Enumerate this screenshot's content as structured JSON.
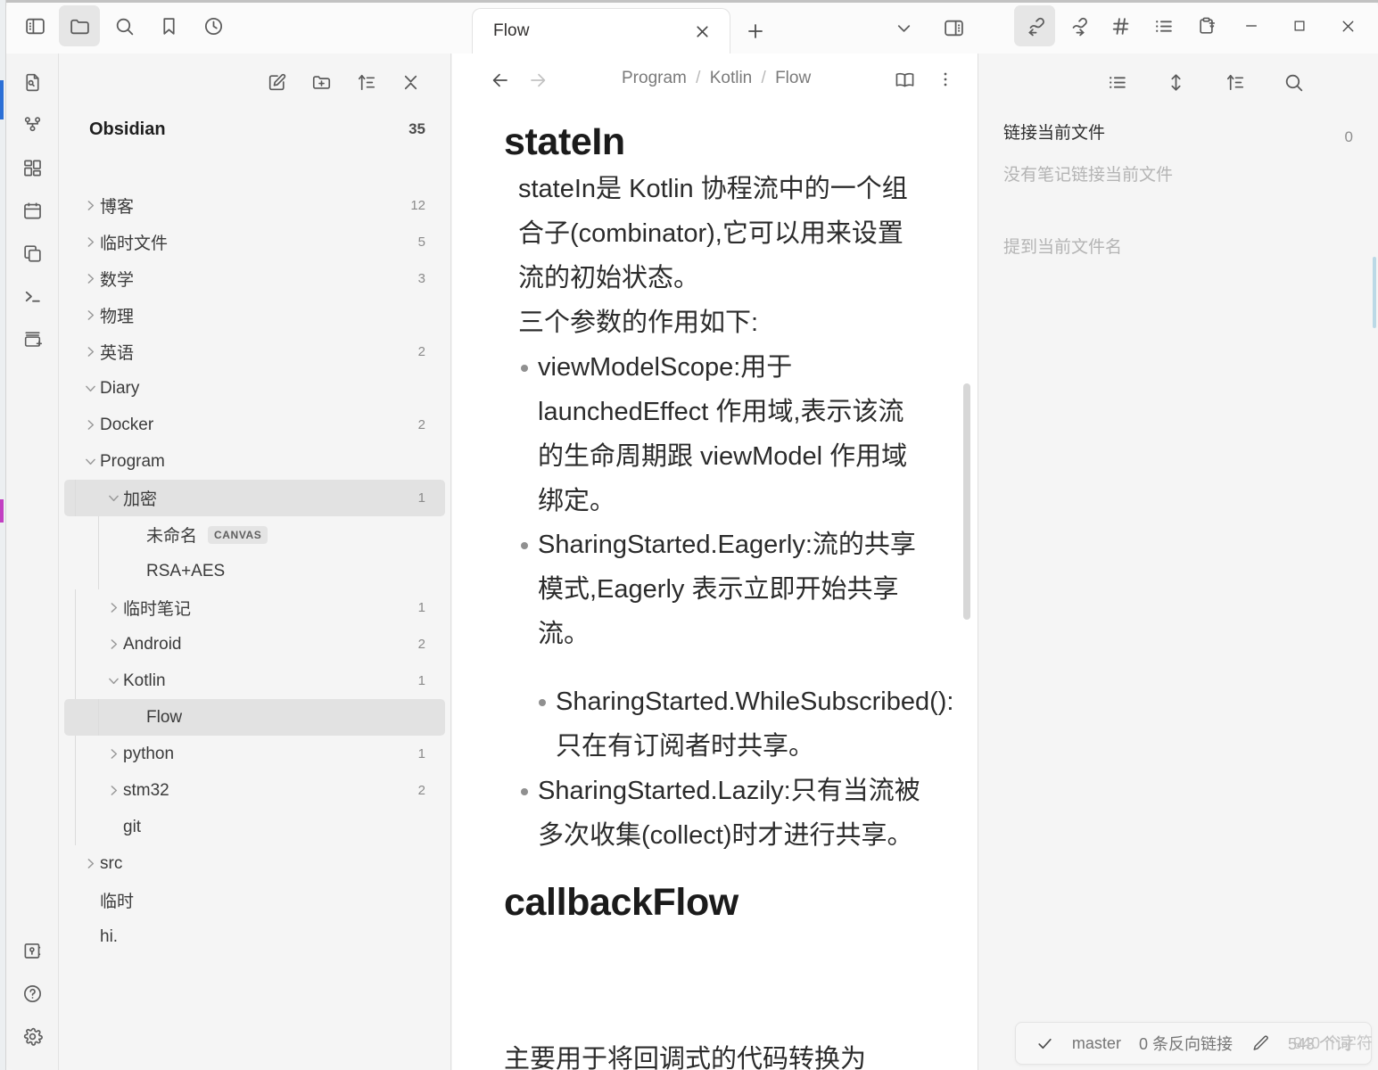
{
  "window": {
    "titlebar_icons": [
      {
        "name": "toggle-left-sidebar-icon",
        "label": "Toggle left sidebar"
      },
      {
        "name": "folder-icon",
        "label": "Files"
      },
      {
        "name": "search-icon",
        "label": "Search"
      },
      {
        "name": "bookmark-icon",
        "label": "Bookmarks"
      },
      {
        "name": "clock-icon",
        "label": "Recent files"
      }
    ],
    "right_icons": [
      {
        "name": "backlinks-icon",
        "label": "Backlinks"
      },
      {
        "name": "outgoing-links-icon",
        "label": "Outgoing links"
      },
      {
        "name": "tags-icon",
        "label": "Tags"
      },
      {
        "name": "outline-icon",
        "label": "Outline"
      },
      {
        "name": "clipboard-icon",
        "label": "Templates"
      }
    ],
    "controls": [
      {
        "name": "minimize-button",
        "label": "Minimize"
      },
      {
        "name": "maximize-button",
        "label": "Maximize"
      },
      {
        "name": "close-button",
        "label": "Close"
      }
    ]
  },
  "tabs": {
    "items": [
      {
        "label": "Flow",
        "active": true
      }
    ],
    "close_label": "×",
    "new_tab_label": "+",
    "dropdown_label": "Tab list",
    "split_label": "Toggle right sidebar"
  },
  "ribbon": {
    "items": [
      {
        "name": "quick-switcher-icon"
      },
      {
        "name": "graph-view-icon"
      },
      {
        "name": "canvas-icon"
      },
      {
        "name": "daily-note-icon"
      },
      {
        "name": "templates-icon"
      },
      {
        "name": "terminal-icon"
      },
      {
        "name": "new-note-icon"
      }
    ],
    "bottom_items": [
      {
        "name": "vault-icon"
      },
      {
        "name": "help-icon"
      },
      {
        "name": "settings-icon"
      }
    ]
  },
  "sidebar": {
    "toolbar": [
      {
        "name": "new-note-icon"
      },
      {
        "name": "new-folder-icon"
      },
      {
        "name": "sort-icon"
      },
      {
        "name": "collapse-all-icon"
      }
    ],
    "vault_name": "Obsidian",
    "vault_count": "35",
    "tree": [
      {
        "label": "博客",
        "count": "12",
        "type": "folder",
        "state": "collapsed",
        "depth": 0
      },
      {
        "label": "临时文件",
        "count": "5",
        "type": "folder",
        "state": "collapsed",
        "depth": 0
      },
      {
        "label": "数学",
        "count": "3",
        "type": "folder",
        "state": "collapsed",
        "depth": 0
      },
      {
        "label": "物理",
        "count": "",
        "type": "folder",
        "state": "collapsed",
        "depth": 0
      },
      {
        "label": "英语",
        "count": "2",
        "type": "folder",
        "state": "collapsed",
        "depth": 0
      },
      {
        "label": "Diary",
        "count": "",
        "type": "folder",
        "state": "expanded",
        "depth": 0
      },
      {
        "label": "Docker",
        "count": "2",
        "type": "folder",
        "state": "collapsed",
        "depth": 0
      },
      {
        "label": "Program",
        "count": "",
        "type": "folder",
        "state": "expanded",
        "depth": 0
      },
      {
        "label": "加密",
        "count": "1",
        "type": "folder",
        "state": "expanded",
        "depth": 1,
        "highlighted": true
      },
      {
        "label": "未命名",
        "count": "",
        "type": "file",
        "depth": 2,
        "tag": "CANVAS"
      },
      {
        "label": "RSA+AES",
        "count": "",
        "type": "file",
        "depth": 2
      },
      {
        "label": "临时笔记",
        "count": "1",
        "type": "folder",
        "state": "collapsed",
        "depth": 1
      },
      {
        "label": "Android",
        "count": "2",
        "type": "folder",
        "state": "collapsed",
        "depth": 1
      },
      {
        "label": "Kotlin",
        "count": "1",
        "type": "folder",
        "state": "expanded",
        "depth": 1
      },
      {
        "label": "Flow",
        "count": "",
        "type": "file",
        "depth": 2,
        "selected": true
      },
      {
        "label": "python",
        "count": "1",
        "type": "folder",
        "state": "collapsed",
        "depth": 1
      },
      {
        "label": "stm32",
        "count": "2",
        "type": "folder",
        "state": "collapsed",
        "depth": 1
      },
      {
        "label": "git",
        "count": "",
        "type": "file",
        "depth": 1
      },
      {
        "label": "src",
        "count": "",
        "type": "folder",
        "state": "collapsed",
        "depth": 0
      },
      {
        "label": "临时",
        "count": "",
        "type": "file",
        "depth": 0
      },
      {
        "label": "hi.",
        "count": "",
        "type": "file",
        "depth": 0
      }
    ]
  },
  "editor": {
    "nav_back": "Back",
    "nav_forward": "Forward",
    "breadcrumb": [
      "Program",
      "Kotlin",
      "Flow"
    ],
    "breadcrumb_sep": "/",
    "reading_view_icon": "book-icon",
    "more_options_icon": "more-vertical-icon",
    "document": {
      "h1": "stateIn",
      "intro": "stateIn是 Kotlin 协程流中的一个组合子(combinator),它可以用来设置流的初始状态。",
      "params_intro": "三个参数的作用如下:",
      "bullets": [
        "viewModelScope:用于 launchedEffect 作用域,表示该流的生命周期跟 viewModel 作用域绑定。",
        "SharingStarted.Eagerly:流的共享模式,Eagerly 表示立即开始共享流。"
      ],
      "nested_bullet": "SharingStarted.WhileSubscribed():只在有订阅者时共享。",
      "bullet_last": "SharingStarted.Lazily:只有当流被多次收集(collect)时才进行共享。",
      "h1_second": "callbackFlow",
      "tail_line": "主要用于将回调式的代码转换为"
    }
  },
  "right_panel": {
    "toolbar": [
      {
        "name": "list-icon"
      },
      {
        "name": "expand-collapse-icon"
      },
      {
        "name": "sort-icon"
      },
      {
        "name": "search-icon"
      }
    ],
    "linked_title": "链接当前文件",
    "linked_count": "0",
    "linked_empty": "没有笔记链接当前文件",
    "unlinked_title": "提到当前文件名"
  },
  "statusbar": {
    "sync_icon": "check-icon",
    "branch": "master",
    "backlinks": "0 条反向链接",
    "edit_icon": "pencil-icon",
    "word_count": "543 个词",
    "char_count": "940 个字符"
  },
  "colors": {
    "accent": "#2b6fd6",
    "selection": "#e2e2e2",
    "panel_bg": "#f5f5f5",
    "editor_bg": "#ffffff",
    "text": "#2b2b2b",
    "muted": "#8a8a8a"
  }
}
